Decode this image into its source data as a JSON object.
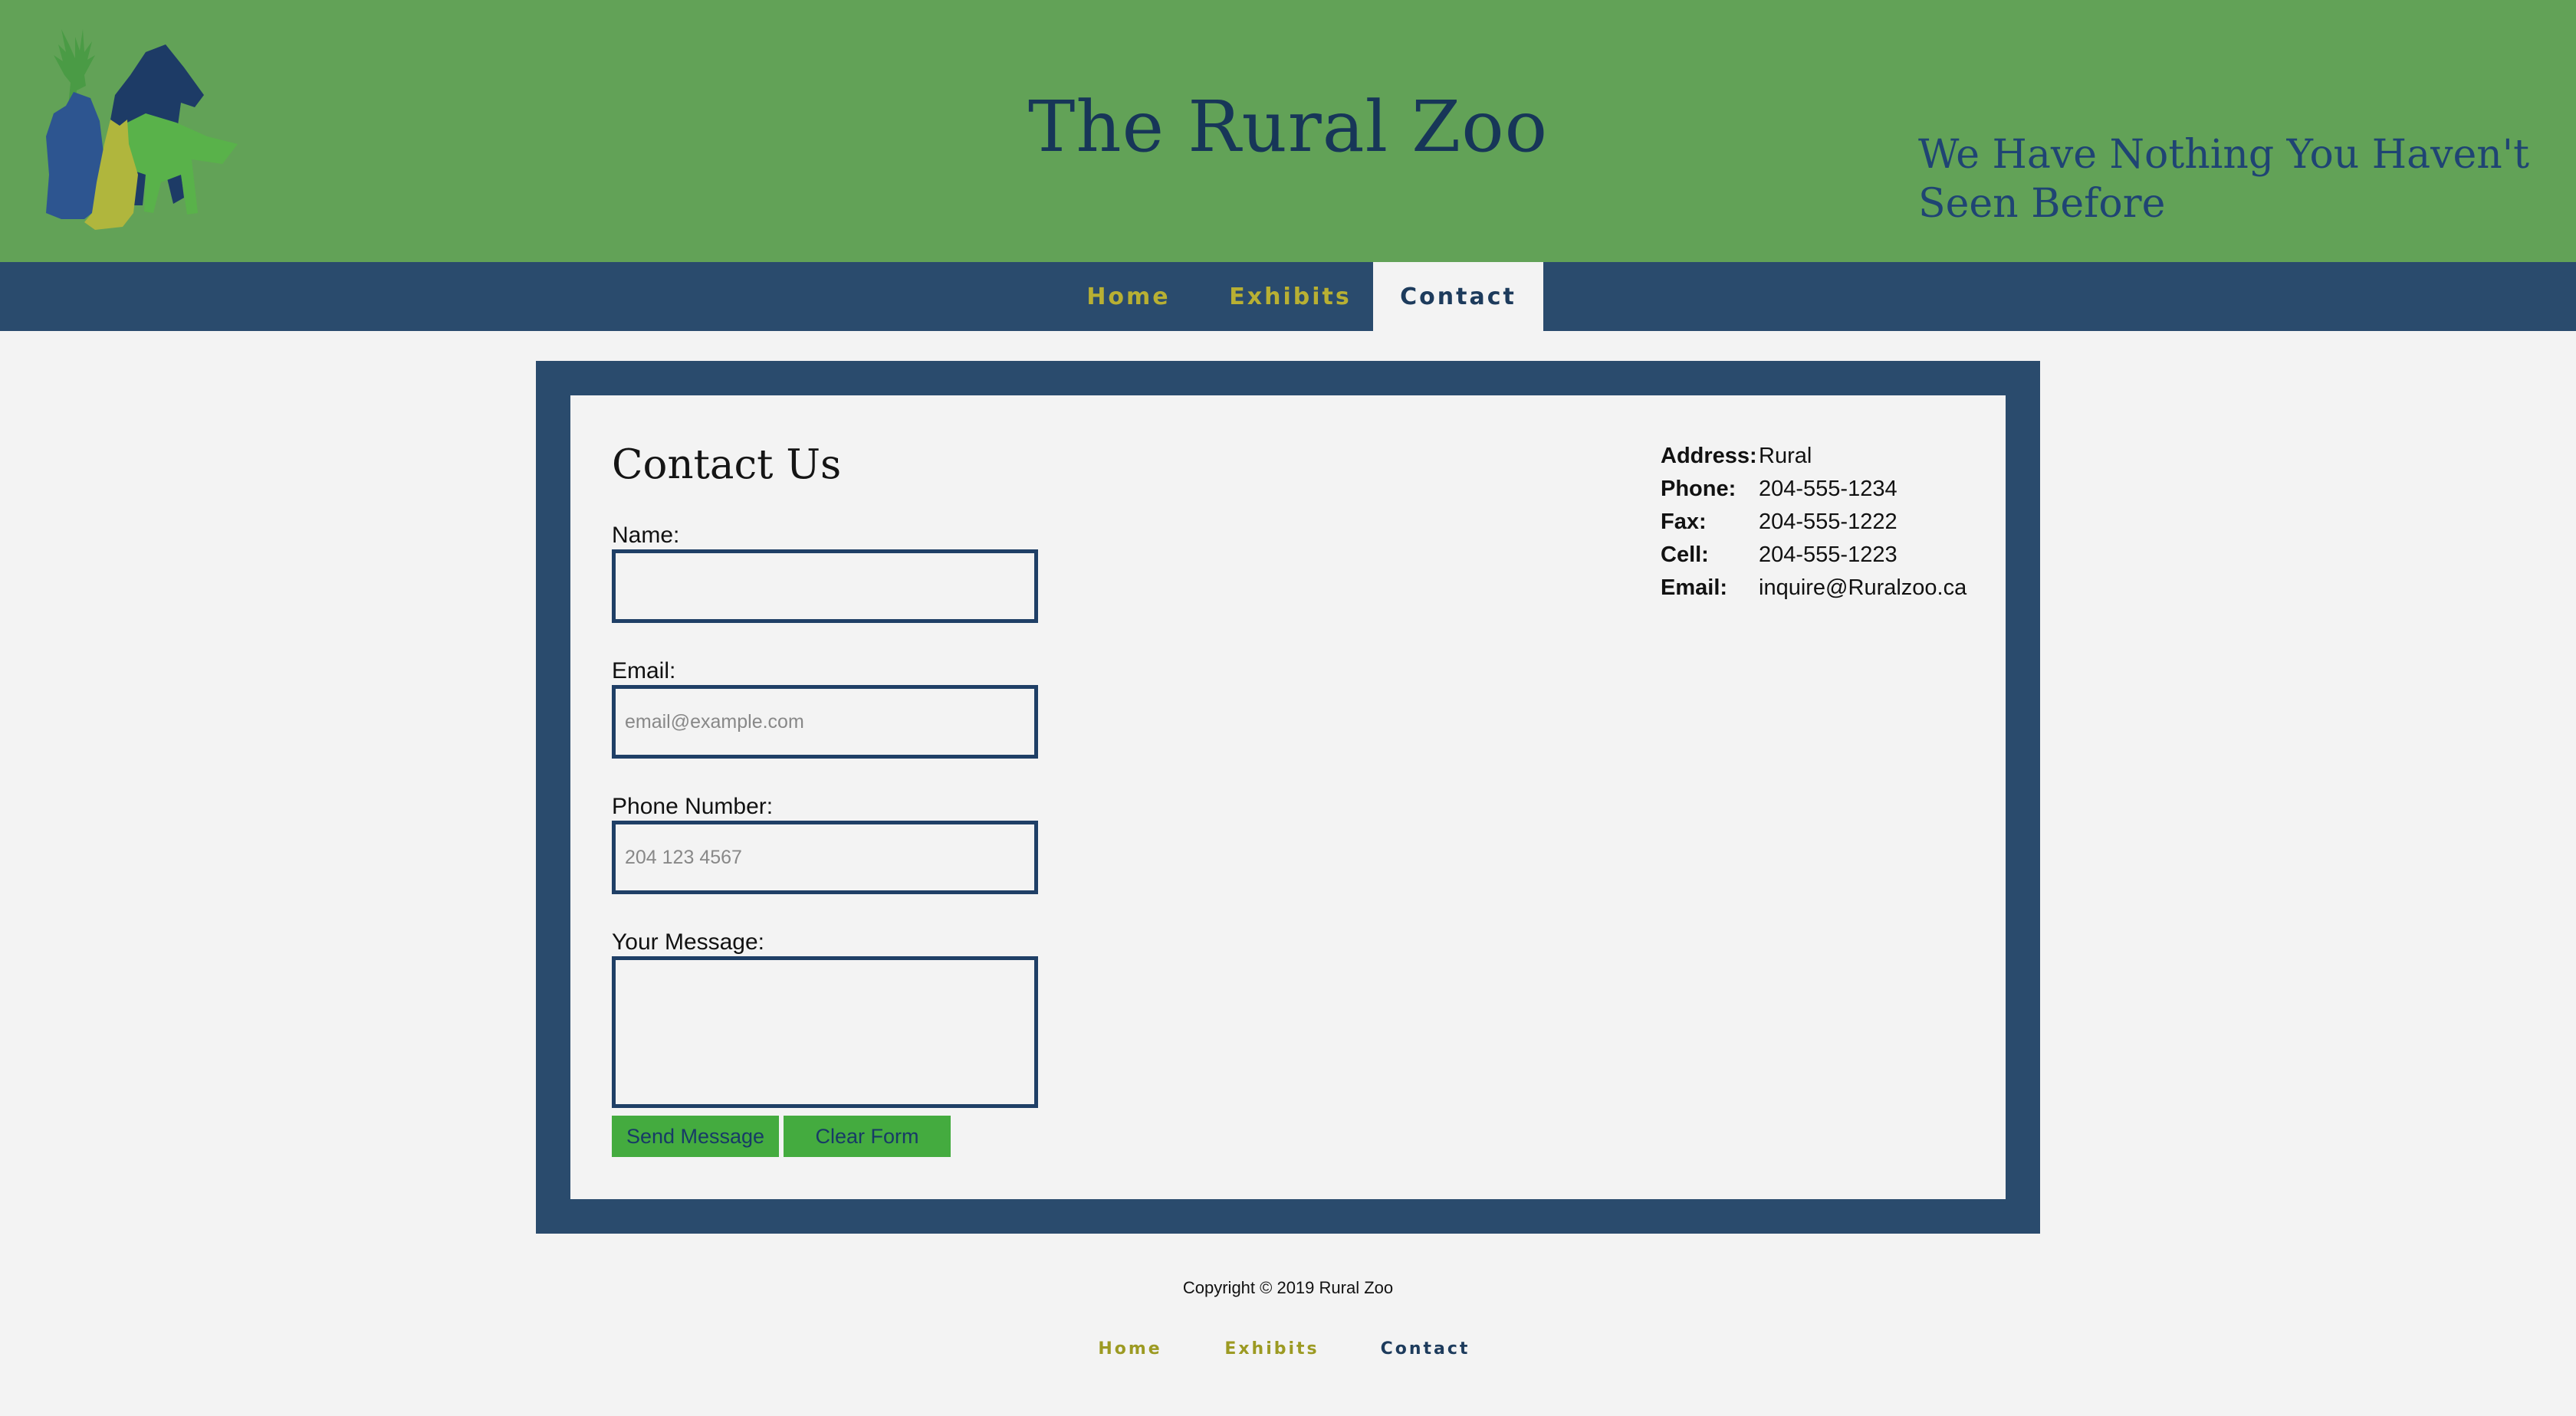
{
  "header": {
    "title": "The Rural Zoo",
    "tagline": "We Have Nothing You Haven't Seen Before",
    "logo_icon": "animal-silhouettes-logo"
  },
  "nav": {
    "items": [
      {
        "label": "Home"
      },
      {
        "label": "Exhibits"
      },
      {
        "label": "Contact",
        "active": true
      }
    ]
  },
  "contact": {
    "title": "Contact Us",
    "fields": {
      "name": {
        "label": "Name:",
        "value": "",
        "placeholder": ""
      },
      "email": {
        "label": "Email:",
        "value": "",
        "placeholder": "email@example.com"
      },
      "phone": {
        "label": "Phone Number:",
        "value": "",
        "placeholder": "204 123 4567"
      },
      "message": {
        "label": "Your Message:",
        "value": "",
        "placeholder": ""
      }
    },
    "buttons": {
      "send": "Send Message",
      "clear": "Clear Form"
    }
  },
  "info": [
    {
      "key": "Address:",
      "value": "Rural"
    },
    {
      "key": "Phone:",
      "value": "204-555-1234"
    },
    {
      "key": "Fax:",
      "value": "204-555-1222"
    },
    {
      "key": "Cell:",
      "value": "204-555-1223"
    },
    {
      "key": "Email:",
      "value": "inquire@Ruralzoo.ca"
    }
  ],
  "footer": {
    "copyright": "Copyright © 2019 Rural Zoo",
    "links": [
      {
        "label": "Home"
      },
      {
        "label": "Exhibits"
      },
      {
        "label": "Contact"
      }
    ]
  },
  "colors": {
    "header_green": "#62a257",
    "nav_blue": "#2a4b6d",
    "title_navy": "#173658",
    "nav_gold": "#b8b033",
    "button_green": "#44ab3f"
  }
}
